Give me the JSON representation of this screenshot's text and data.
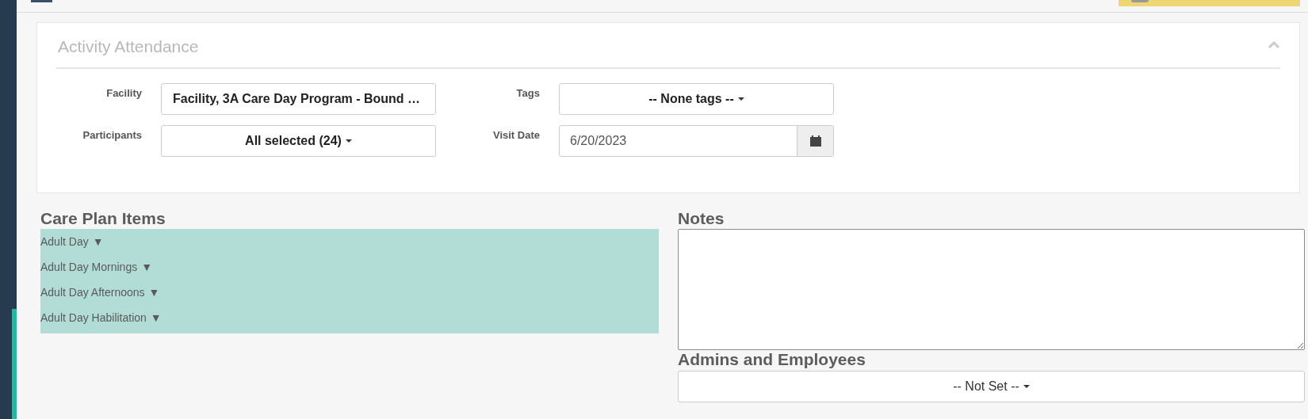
{
  "panel": {
    "title": "Activity Attendance",
    "expanded": true
  },
  "filters": [
    {
      "label": "Facility",
      "kind": "dropdown",
      "value": "Facility, 3A Care Day Program - Bound …",
      "caret": false
    },
    {
      "label": "Tags",
      "kind": "dropdown",
      "value": "-- None tags --",
      "caret": true
    },
    {
      "label": "Participants",
      "kind": "dropdown",
      "value": "All selected (24)",
      "caret": true
    },
    {
      "label": "Visit Date",
      "kind": "date",
      "value": "6/20/2023"
    }
  ],
  "care_plan": {
    "title": "Care Plan Items",
    "items": [
      {
        "label": "Adult Day",
        "toggle": "▼"
      },
      {
        "label": "Adult Day Mornings",
        "toggle": "▼"
      },
      {
        "label": "Adult Day Afternoons",
        "toggle": "▼"
      },
      {
        "label": "Adult Day Habilitation",
        "toggle": "▼"
      }
    ]
  },
  "notes": {
    "title": "Notes"
  },
  "admins": {
    "title": "Admins and Employees",
    "value": "-- Not Set --"
  }
}
